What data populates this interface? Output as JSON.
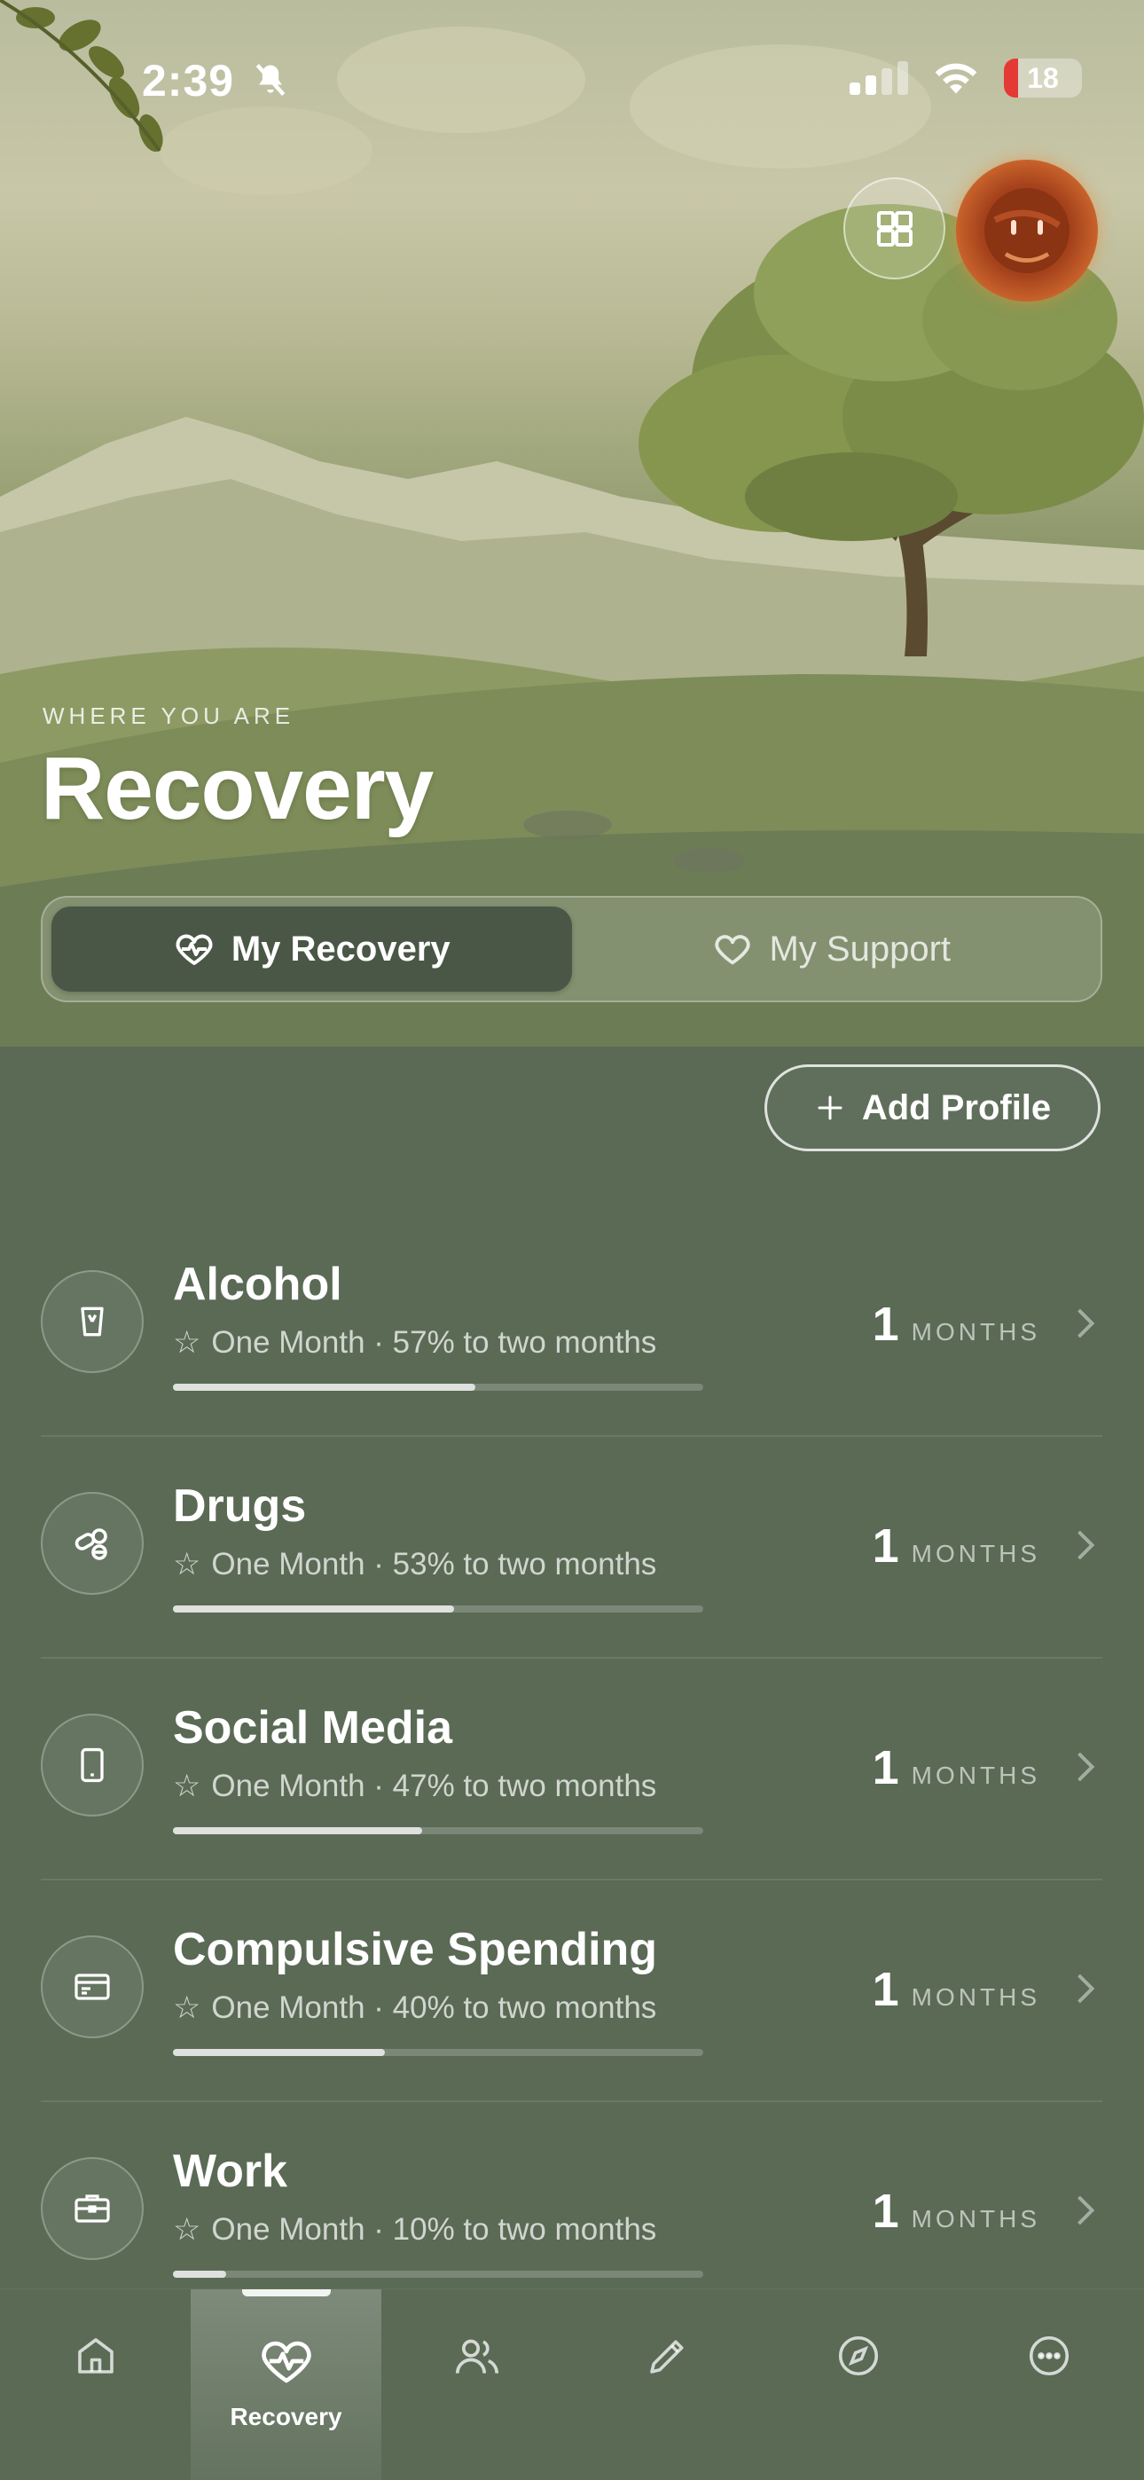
{
  "status_bar": {
    "time": "2:39",
    "battery": "18",
    "icons": [
      "bell-slash-icon",
      "cellular-signal-icon",
      "wifi-icon",
      "battery-icon"
    ]
  },
  "header": {
    "eyebrow": "WHERE YOU ARE",
    "title": "Recovery",
    "buttons": [
      "grid-icon",
      "avatar"
    ]
  },
  "segmented": {
    "tabs": [
      {
        "label": "My Recovery",
        "icon": "heart-pulse-icon",
        "active": true
      },
      {
        "label": "My Support",
        "icon": "heart-outline-icon",
        "active": false
      }
    ]
  },
  "add_profile": {
    "label": "Add Profile",
    "icon": "plus-icon"
  },
  "profiles": [
    {
      "name": "Alcohol",
      "icon": "glass-icon",
      "milestone": "One Month",
      "progress_text": "57% to two months",
      "progress": 0.57,
      "value": "1",
      "unit": "MONTHS"
    },
    {
      "name": "Drugs",
      "icon": "pills-icon",
      "milestone": "One Month",
      "progress_text": "53% to two months",
      "progress": 0.53,
      "value": "1",
      "unit": "MONTHS"
    },
    {
      "name": "Social Media",
      "icon": "phone-icon",
      "milestone": "One Month",
      "progress_text": "47% to two months",
      "progress": 0.47,
      "value": "1",
      "unit": "MONTHS"
    },
    {
      "name": "Compulsive Spending",
      "icon": "credit-card-icon",
      "milestone": "One Month",
      "progress_text": "40% to two months",
      "progress": 0.4,
      "value": "1",
      "unit": "MONTHS"
    },
    {
      "name": "Work",
      "icon": "briefcase-icon",
      "milestone": "One Month",
      "progress_text": "10% to two months",
      "progress": 0.1,
      "value": "1",
      "unit": "MONTHS"
    }
  ],
  "tabbar": {
    "items": [
      {
        "icon": "home-icon",
        "label": "",
        "active": false
      },
      {
        "icon": "heart-pulse-icon",
        "label": "Recovery",
        "active": true
      },
      {
        "icon": "people-icon",
        "label": "",
        "active": false
      },
      {
        "icon": "pencil-icon",
        "label": "",
        "active": false
      },
      {
        "icon": "compass-icon",
        "label": "",
        "active": false
      },
      {
        "icon": "more-icon",
        "label": "",
        "active": false
      }
    ]
  },
  "colors": {
    "background": "#5a6a55",
    "active_segment": "#4a5646",
    "battery_low": "#e53935",
    "avatar": "#a5421c"
  }
}
